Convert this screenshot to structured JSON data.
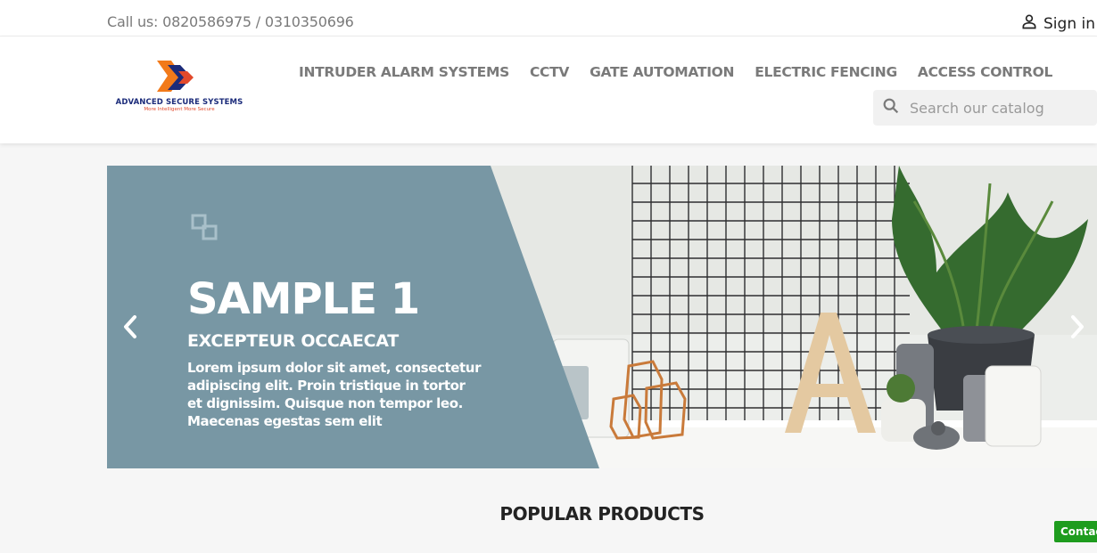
{
  "topbar": {
    "call_text": "Call us: 0820586975 / 0310350696",
    "signin_label": "Sign in",
    "signin_icon": "user-icon"
  },
  "header": {
    "logo_text": "ADVANCED SECURE SYSTEMS",
    "logo_tagline": "More Intelligent More Secure",
    "nav": [
      {
        "label": "INTRUDER ALARM SYSTEMS"
      },
      {
        "label": "CCTV"
      },
      {
        "label": "GATE AUTOMATION"
      },
      {
        "label": "ELECTRIC FENCING"
      },
      {
        "label": "ACCESS CONTROL"
      }
    ],
    "search": {
      "placeholder": "Search our catalog",
      "icon": "search-icon"
    }
  },
  "slider": {
    "title": "SAMPLE 1",
    "subtitle": "EXCEPTEUR OCCAECAT",
    "text": "Lorem ipsum dolor sit amet, consectetur adipiscing elit. Proin tristique in tortor et dignissim. Quisque non tempor leo. Maecenas egestas sem elit",
    "prev_icon": "chevron-left-icon",
    "next_icon": "chevron-right-icon",
    "panel_color": "#7897a4"
  },
  "main": {
    "section_title": "POPULAR PRODUCTS"
  },
  "contact_button": {
    "label": "Contact"
  },
  "colors": {
    "logo_orange": "#f27a1a",
    "logo_navy": "#1b2b7a",
    "contact_green": "#1e9c1e"
  }
}
